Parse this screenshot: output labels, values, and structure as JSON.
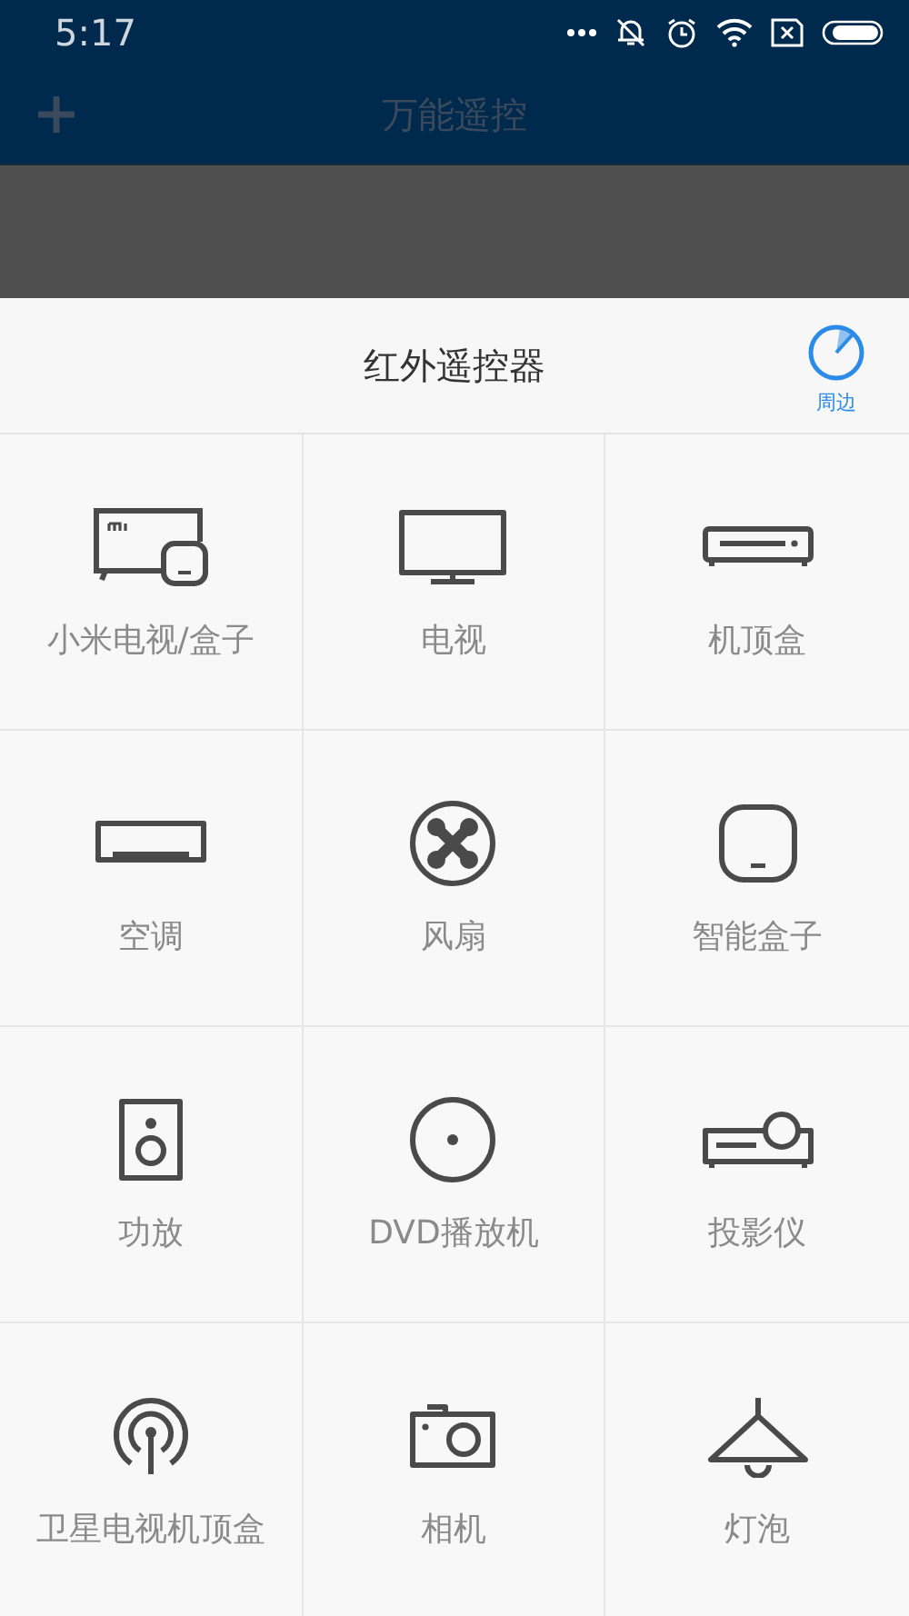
{
  "status_bar": {
    "time": "5:17"
  },
  "app_bar": {
    "title": "万能遥控"
  },
  "sheet": {
    "title": "红外遥控器",
    "nearby_label": "周边",
    "devices": [
      {
        "label": "小米电视/盒子",
        "kind": "mitv"
      },
      {
        "label": "电视",
        "kind": "tv"
      },
      {
        "label": "机顶盒",
        "kind": "stb"
      },
      {
        "label": "空调",
        "kind": "ac"
      },
      {
        "label": "风扇",
        "kind": "fan"
      },
      {
        "label": "智能盒子",
        "kind": "box"
      },
      {
        "label": "功放",
        "kind": "speaker"
      },
      {
        "label": "DVD播放机",
        "kind": "dvd"
      },
      {
        "label": "投影仪",
        "kind": "projector"
      },
      {
        "label": "卫星电视机顶盒",
        "kind": "satellite"
      },
      {
        "label": "相机",
        "kind": "camera"
      },
      {
        "label": "灯泡",
        "kind": "lamp"
      }
    ]
  }
}
